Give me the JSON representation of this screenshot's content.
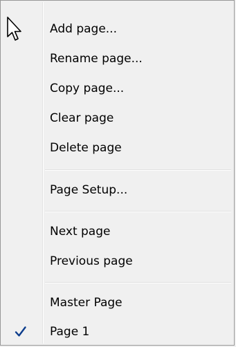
{
  "menu": {
    "items": [
      {
        "label": "Add page..."
      },
      {
        "label": "Rename page..."
      },
      {
        "label": "Copy page..."
      },
      {
        "label": "Clear page"
      },
      {
        "label": "Delete page"
      },
      {
        "label": "Page Setup..."
      },
      {
        "label": "Next page"
      },
      {
        "label": "Previous page"
      },
      {
        "label": "Master Page"
      },
      {
        "label": "Page 1",
        "checked": true
      }
    ]
  },
  "icons": {
    "cursor": "mouse-pointer-icon",
    "check": "checkmark-icon"
  },
  "colors": {
    "background": "#f0f0f0",
    "border": "#979797",
    "check": "#0c3c8c"
  }
}
